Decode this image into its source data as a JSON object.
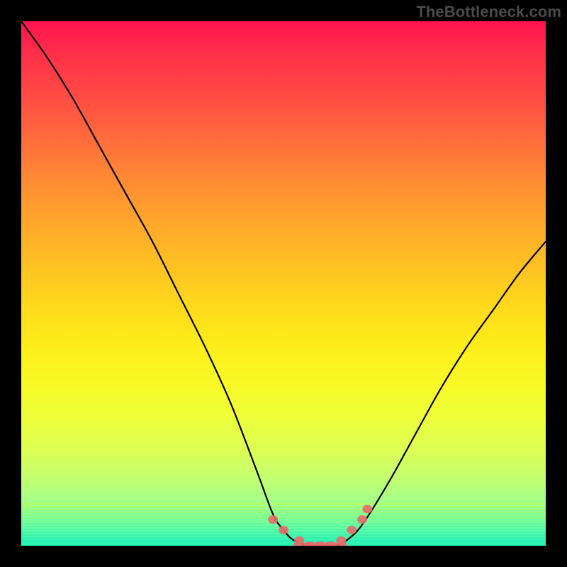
{
  "watermark": "TheBottleneck.com",
  "colors": {
    "frame": "#000000",
    "curve": "#000000",
    "marker": "#e86a6a",
    "gradient_top": "#ff1350",
    "gradient_bottom": "#26f3b5"
  },
  "chart_data": {
    "type": "line",
    "title": "",
    "xlabel": "",
    "ylabel": "",
    "xlim": [
      0,
      100
    ],
    "ylim": [
      0,
      100
    ],
    "grid": false,
    "series": [
      {
        "name": "bottleneck-curve",
        "x": [
          0,
          5,
          10,
          15,
          20,
          25,
          30,
          35,
          40,
          45,
          48,
          50,
          52,
          55,
          58,
          60,
          62,
          65,
          70,
          75,
          80,
          85,
          90,
          95,
          100
        ],
        "y": [
          100,
          93,
          85,
          76,
          67,
          58,
          48,
          38,
          27,
          14,
          6,
          3,
          1,
          0,
          0,
          0,
          1,
          4,
          12,
          21,
          30,
          38,
          45,
          52,
          58
        ]
      }
    ],
    "markers": {
      "name": "bottom-markers",
      "points": [
        {
          "x": 48,
          "y": 5
        },
        {
          "x": 50,
          "y": 3
        },
        {
          "x": 53,
          "y": 1
        },
        {
          "x": 55,
          "y": 0
        },
        {
          "x": 57,
          "y": 0
        },
        {
          "x": 59,
          "y": 0
        },
        {
          "x": 61,
          "y": 1
        },
        {
          "x": 63,
          "y": 3
        },
        {
          "x": 65,
          "y": 5
        },
        {
          "x": 66,
          "y": 7
        }
      ]
    }
  }
}
